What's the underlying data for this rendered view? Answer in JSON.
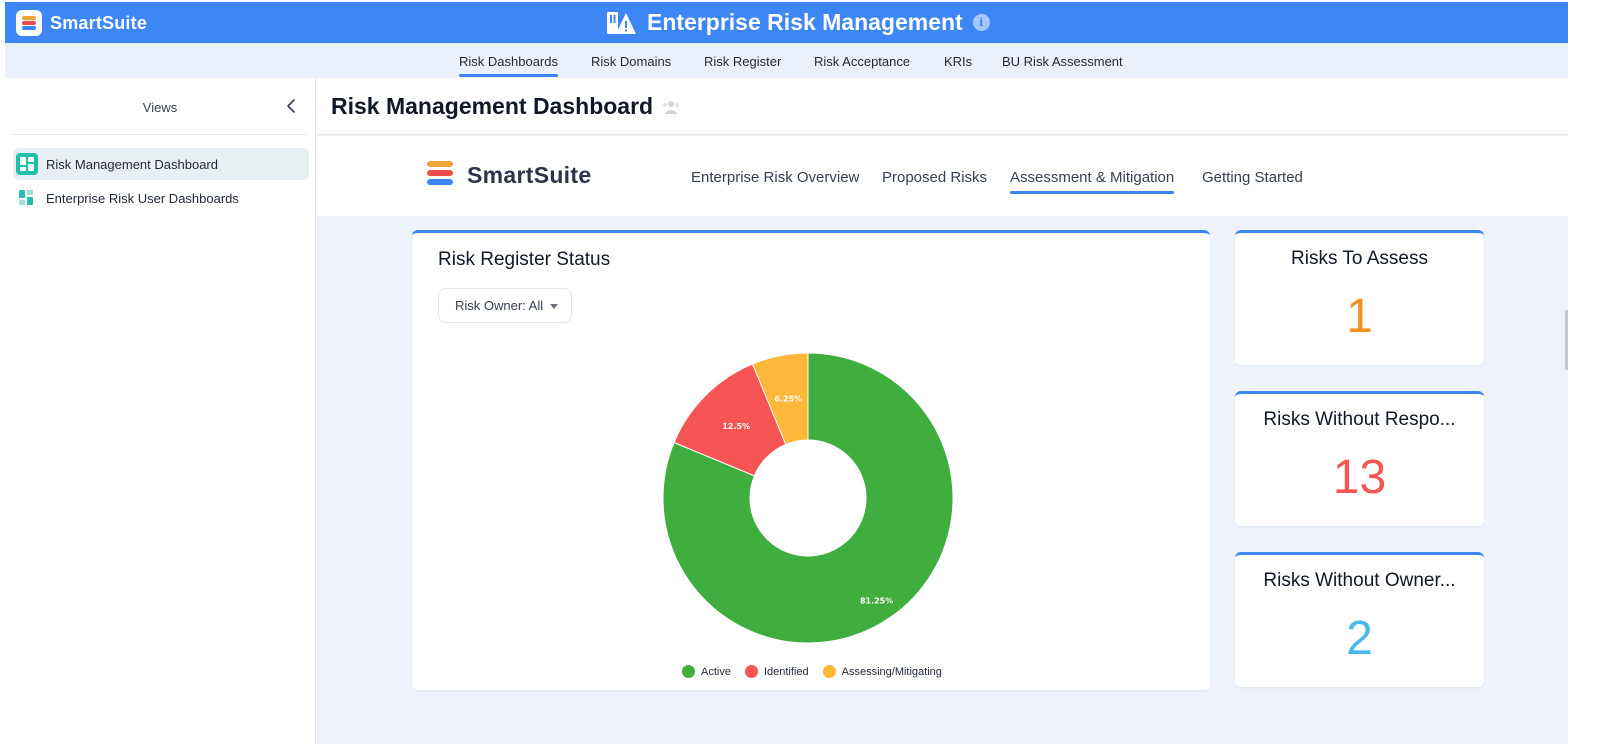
{
  "topbar": {
    "brand_name": "SmartSuite",
    "app_title": "Enterprise Risk Management",
    "info_glyph": "i",
    "color": "#3c86f5"
  },
  "nav": {
    "tabs": [
      {
        "label": "Risk Dashboards",
        "active": true
      },
      {
        "label": "Risk Domains",
        "active": false
      },
      {
        "label": "Risk Register",
        "active": false
      },
      {
        "label": "Risk Acceptance",
        "active": false
      },
      {
        "label": "KRIs",
        "active": false
      },
      {
        "label": "BU Risk Assessment",
        "active": false
      }
    ]
  },
  "sidebar": {
    "title": "Views",
    "items": [
      {
        "label": "Risk Management Dashboard",
        "icon": "dashboard-icon",
        "selected": true
      },
      {
        "label": "Enterprise Risk User Dashboards",
        "icon": "dashboard-icon",
        "selected": false
      }
    ]
  },
  "main": {
    "page_title": "Risk Management Dashboard",
    "logo_word": "SmartSuite",
    "dash_tabs": [
      {
        "label": "Enterprise Risk Overview",
        "active": false
      },
      {
        "label": "Proposed Risks",
        "active": false
      },
      {
        "label": "Assessment & Mitigation",
        "active": true
      },
      {
        "label": "Getting Started",
        "active": false
      }
    ]
  },
  "chart_card": {
    "title": "Risk Register Status",
    "filter_label": "Risk Owner: All"
  },
  "chart_data": {
    "type": "pie",
    "title": "Risk Register Status",
    "donut": true,
    "categories": [
      "Active",
      "Identified",
      "Assessing/Mitigating"
    ],
    "values": [
      81.25,
      12.5,
      6.25
    ],
    "labels": [
      "81.25%",
      "12.5%",
      "6.25%"
    ],
    "colors": [
      "#40ad3f",
      "#f75454",
      "#fdb83a"
    ],
    "legend": "bottom"
  },
  "kpis": [
    {
      "title": "Risks To Assess",
      "value": "1",
      "color": "#f39221"
    },
    {
      "title": "Risks Without Respo...",
      "value": "13",
      "color": "#f75454"
    },
    {
      "title": "Risks Without Owner...",
      "value": "2",
      "color": "#48b9ec"
    }
  ]
}
